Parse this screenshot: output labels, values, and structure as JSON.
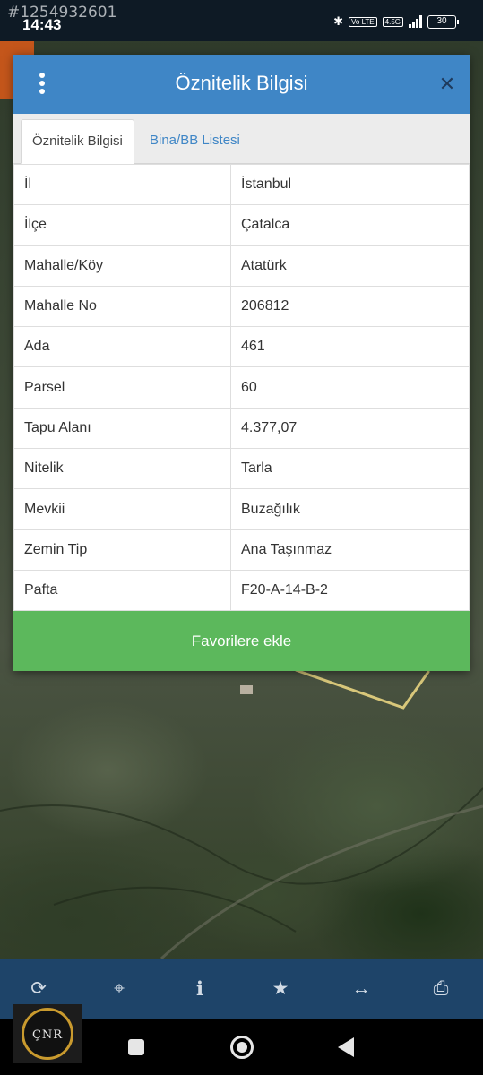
{
  "status_bar": {
    "watermark_id": "#1254932601",
    "time": "14:43",
    "network_label": "4.5G",
    "volte_label": "Vo LTE",
    "battery": "30"
  },
  "dialog": {
    "title": "Öznitelik Bilgisi",
    "tabs": [
      {
        "label": "Öznitelik Bilgisi",
        "active": true
      },
      {
        "label": "Bina/BB Listesi",
        "active": false
      }
    ],
    "rows": [
      {
        "key": "İl",
        "value": "İstanbul"
      },
      {
        "key": "İlçe",
        "value": "Çatalca"
      },
      {
        "key": "Mahalle/Köy",
        "value": "Atatürk"
      },
      {
        "key": "Mahalle No",
        "value": "206812"
      },
      {
        "key": "Ada",
        "value": "461"
      },
      {
        "key": "Parsel",
        "value": "60"
      },
      {
        "key": "Tapu Alanı",
        "value": "4.377,07"
      },
      {
        "key": "Nitelik",
        "value": "Tarla"
      },
      {
        "key": "Mevkii",
        "value": "Buzağılık"
      },
      {
        "key": "Zemin Tip",
        "value": "Ana Taşınmaz"
      },
      {
        "key": "Pafta",
        "value": "F20-A-14-B-2"
      }
    ],
    "favorite_label": "Favorilere ekle"
  },
  "toolbar": {
    "items": [
      "refresh-icon",
      "locate-icon",
      "info-icon",
      "star-icon",
      "measure-icon",
      "print-icon"
    ]
  },
  "logo": {
    "text": "ÇNR"
  },
  "colors": {
    "header": "#3f86c6",
    "favorite": "#5cb85c",
    "toolbar": "#1e4469",
    "parcel_outline": "#d8c77a"
  }
}
